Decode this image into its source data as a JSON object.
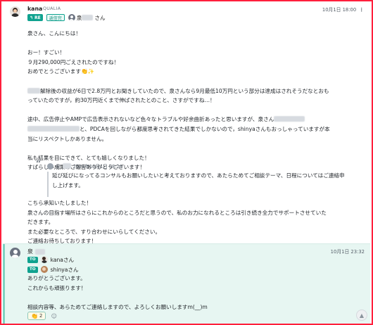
{
  "colors": {
    "frame": "#ff1f3c",
    "accent": "#0fa28f",
    "reply_bg": "#e7f6f2"
  },
  "message1": {
    "sender": "kana",
    "org": "QUALIA",
    "time": "10月1日 18:00",
    "more_icon": "more-dots-icon",
    "re_label": "RE",
    "status_label": "返信完",
    "to_suffix": "さん",
    "lines": [
      "泉さん、こんにちは！",
      "",
      "おー！すごい！",
      "９月290,000円ごえされたのですね！",
      "おめでとうございます",
      "",
      "解除後の収益が6日で2.8万円とお聞きしていたので、泉さんなら9月最低10万円という部分は達成はされそうだなとおも",
      "っていたのですが，約30万円近くまで伸ばされたとのこと、さすがですね…！",
      "",
      "途中、広告停止やAMPで広告表示されないなど色々なトラブルや好余曲折あったと思いますが、泉さん",
      "と、PDCAを回しながら都度思考されてきた結果でしかないので，shinyaさんもおっしゃっていますが本",
      "当にリスペクトしかありません。",
      "",
      "私も結果を目にできて、とても嬉しくなりました！",
      "すばらしい成果のご報告ありがとうございます！"
    ],
    "quote": {
      "name": "泉",
      "date": "2024年10月1日 08:26",
      "lines": [
        "延び延びになってるコンサルもお願いしたいと考えておりますので、あたらためてご相談テーマ、日程についてはご連絡申",
        "し上げます。"
      ]
    },
    "lines_after": [
      "こちら承知いたしました！",
      "泉さんの目指す場所はさらにこれからのところだと思うので、私のお力になれるところは引き続き全力でサポートさせていた",
      "だきます。",
      "また必要なところで、すり合わせにいらしてください。",
      "ご連絡お待ちしております！"
    ]
  },
  "message2": {
    "sender": "泉",
    "time": "10月1日 23:32",
    "to_label": "TO",
    "to": [
      "kanaさん",
      "shinyaさん"
    ],
    "lines": [
      "ありがとうございます。",
      "これからも頑張ります！",
      "",
      "相談内容等、あらためてご連絡しますので、よろしくお願いしますm(__)m"
    ],
    "reaction_count": "2",
    "reaction_icon": "clap-emoji-icon",
    "add_reaction_icon": "add-reaction-icon",
    "scroll_icon": "arrow-up-icon"
  }
}
